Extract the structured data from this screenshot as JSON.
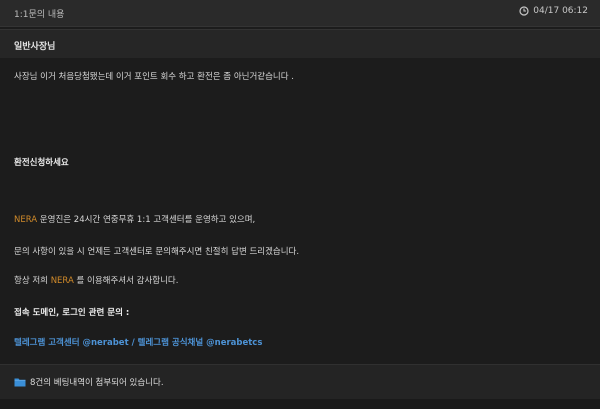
{
  "topbar": {
    "title": "1:1문의 내용",
    "timestamp": "04/17 06:12",
    "clock_icon": "clock-icon"
  },
  "header": {
    "name": "일반사장님"
  },
  "message": {
    "line1": "사장님 이거 처음당첨됐는데  이거 포인트 회수 하고 환전은 좀 아닌거같습니다 .",
    "line2": "환전신청하세요",
    "line3_brand": "NERA",
    "line3_rest": " 운영진은 24시간 연중무휴 1:1 고객센터를 운영하고 있으며,",
    "line4": "문의 사항이 있을 시 언제든 고객센터로 문의해주시면 친절히 답변 드리겠습니다.",
    "line5_pre": "항상 저희 ",
    "line5_brand": "NERA",
    "line5_post": " 를 이용해주셔서 감사합니다.",
    "line6": "접속 도메인, 로그인 관련 문의 :",
    "link1": "텔레그램 고객센터 @nerabet",
    "link_sep": "  /  ",
    "link2": "텔레그램 공식채널 @nerabetcs"
  },
  "footer": {
    "attachment_text": "8건의 베팅내역이 첨부되어 있습니다.",
    "folder_icon": "folder-icon"
  },
  "colors": {
    "background": "#1c1c1c",
    "brand": "#d08a2a",
    "link": "#4d93d6",
    "folder": "#3a8fd8"
  }
}
